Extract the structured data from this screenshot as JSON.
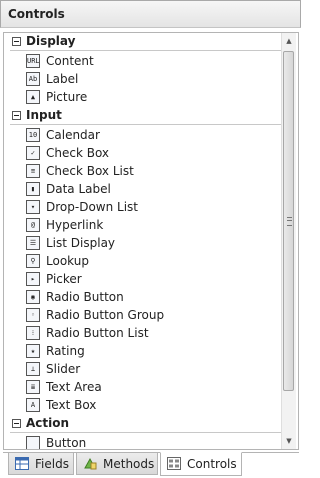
{
  "title": "Controls",
  "categories": [
    {
      "label": "Display",
      "items": [
        {
          "label": "Content",
          "icon": "url-icon",
          "glyph": "URL"
        },
        {
          "label": "Label",
          "icon": "label-icon",
          "glyph": "Ab"
        },
        {
          "label": "Picture",
          "icon": "picture-icon",
          "glyph": "▲"
        }
      ]
    },
    {
      "label": "Input",
      "items": [
        {
          "label": "Calendar",
          "icon": "calendar-icon",
          "glyph": "10"
        },
        {
          "label": "Check Box",
          "icon": "checkbox-icon",
          "glyph": "✓"
        },
        {
          "label": "Check Box List",
          "icon": "checkbox-list-icon",
          "glyph": "≡"
        },
        {
          "label": "Data Label",
          "icon": "data-label-icon",
          "glyph": "▮"
        },
        {
          "label": "Drop-Down List",
          "icon": "dropdown-icon",
          "glyph": "▾"
        },
        {
          "label": "Hyperlink",
          "icon": "hyperlink-icon",
          "glyph": "@"
        },
        {
          "label": "List Display",
          "icon": "list-display-icon",
          "glyph": "☰"
        },
        {
          "label": "Lookup",
          "icon": "lookup-icon",
          "glyph": "⚲"
        },
        {
          "label": "Picker",
          "icon": "picker-icon",
          "glyph": "▸"
        },
        {
          "label": "Radio Button",
          "icon": "radio-icon",
          "glyph": "◉"
        },
        {
          "label": "Radio Button Group",
          "icon": "radio-group-icon",
          "glyph": "◦"
        },
        {
          "label": "Radio Button List",
          "icon": "radio-list-icon",
          "glyph": "⁝"
        },
        {
          "label": "Rating",
          "icon": "star-icon",
          "glyph": "★"
        },
        {
          "label": "Slider",
          "icon": "slider-icon",
          "glyph": "⊥"
        },
        {
          "label": "Text Area",
          "icon": "textarea-icon",
          "glyph": "≣"
        },
        {
          "label": "Text Box",
          "icon": "textbox-icon",
          "glyph": "A"
        }
      ]
    },
    {
      "label": "Action",
      "items": [
        {
          "label": "Button",
          "icon": "button-icon",
          "glyph": ""
        }
      ]
    }
  ],
  "tabs": [
    {
      "label": "Fields",
      "icon": "fields-icon",
      "active": false
    },
    {
      "label": "Methods",
      "icon": "methods-icon",
      "active": false
    },
    {
      "label": "Controls",
      "icon": "controls-icon",
      "active": true
    }
  ]
}
